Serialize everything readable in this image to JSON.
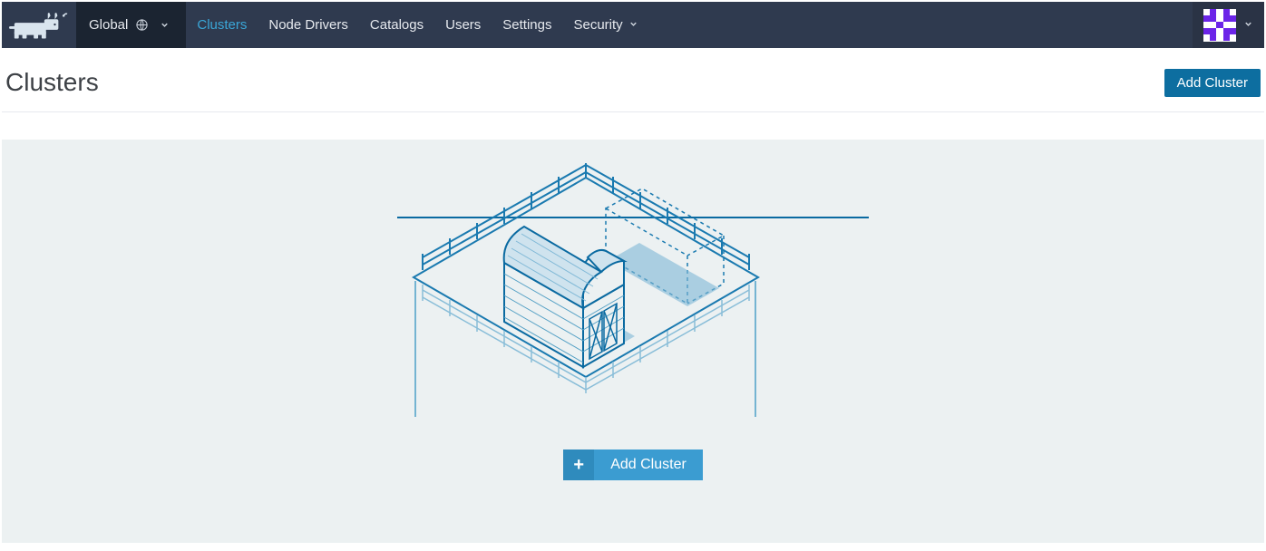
{
  "nav": {
    "scope_label": "Global",
    "items": [
      {
        "label": "Clusters",
        "active": true
      },
      {
        "label": "Node Drivers",
        "active": false
      },
      {
        "label": "Catalogs",
        "active": false
      },
      {
        "label": "Users",
        "active": false
      },
      {
        "label": "Settings",
        "active": false
      },
      {
        "label": "Security",
        "active": false,
        "has_dropdown": true
      }
    ]
  },
  "page": {
    "title": "Clusters",
    "add_button": "Add Cluster"
  },
  "empty_state": {
    "cta_label": "Add Cluster",
    "plus": "+"
  }
}
